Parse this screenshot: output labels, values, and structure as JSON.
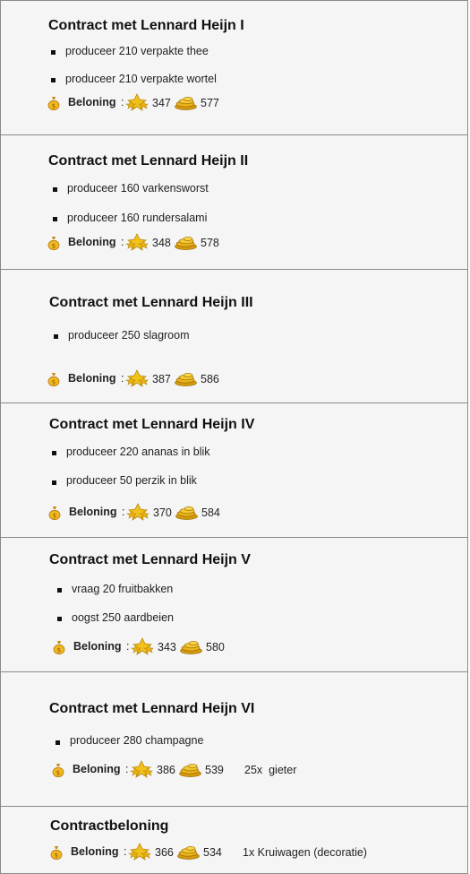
{
  "reward_label": "Beloning",
  "reward_colon": ":",
  "icons": {
    "bag": "money-bag-icon",
    "xp": "gold-star-cluster-icon",
    "coins": "gold-coins-icon"
  },
  "contracts": [
    {
      "title": "Contract met Lennard Heijn I",
      "tasks": [
        "produceer 210 verpakte thee",
        "produceer 210 verpakte wortel"
      ],
      "xp": "347",
      "coins": "577",
      "extra": ""
    },
    {
      "title": "Contract met Lennard Heijn II",
      "tasks": [
        "produceer 160 varkensworst",
        "produceer 160 rundersalami"
      ],
      "xp": "348",
      "coins": "578",
      "extra": ""
    },
    {
      "title": "Contract met Lennard Heijn III",
      "tasks": [
        "produceer 250 slagroom"
      ],
      "xp": "387",
      "coins": "586",
      "extra": ""
    },
    {
      "title": "Contract met Lennard Heijn IV",
      "tasks": [
        "produceer 220 ananas in blik",
        "produceer 50 perzik in blik"
      ],
      "xp": "370",
      "coins": "584",
      "extra": ""
    },
    {
      "title": "Contract met Lennard Heijn V",
      "tasks": [
        "vraag 20 fruitbakken",
        "oogst 250 aardbeien"
      ],
      "xp": "343",
      "coins": "580",
      "extra": ""
    },
    {
      "title": "Contract met Lennard Heijn VI",
      "tasks": [
        "produceer 280 champagne"
      ],
      "xp": "386",
      "coins": "539",
      "extra": "25x  gieter"
    },
    {
      "title": "Contractbeloning",
      "tasks": [],
      "xp": "366",
      "coins": "534",
      "extra": "1x Kruiwagen (decoratie)"
    }
  ]
}
